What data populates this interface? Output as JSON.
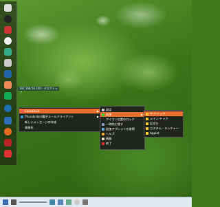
{
  "window": {
    "title_bar_text": "192.168.56.100 - デスクトップ"
  },
  "app_menu": {
    "items": [
      {
        "label": "CairoDock",
        "highlighted": true,
        "has_submenu": true
      },
      {
        "label": "Thunderbird電子メールクライアント",
        "highlighted": false,
        "has_submenu": true
      },
      {
        "label": "新しいメッセージの作成",
        "highlighted": false,
        "has_submenu": false
      },
      {
        "label": "連絡先",
        "highlighted": false,
        "has_submenu": false
      }
    ]
  },
  "cairo_menu": {
    "items": [
      {
        "label": "設定",
        "highlighted": false
      },
      {
        "label": "追加",
        "highlighted": true,
        "has_submenu": true
      },
      {
        "label": "アイコン位置のロック",
        "highlighted": false
      },
      {
        "label": "一時的に隠す",
        "highlighted": false
      },
      {
        "label": "追加アプレットを取得",
        "highlighted": false
      },
      {
        "label": "ヘルプ",
        "highlighted": false
      },
      {
        "label": "情報",
        "highlighted": false
      },
      {
        "label": "終了",
        "highlighted": false
      }
    ]
  },
  "add_menu": {
    "items": [
      {
        "label": "サブ-ドック",
        "highlighted": true
      },
      {
        "label": "メイン-ドック",
        "highlighted": false
      },
      {
        "label": "区切り",
        "highlighted": false
      },
      {
        "label": "カスタム・ランチャー",
        "highlighted": false
      },
      {
        "label": "Applet",
        "highlighted": false
      }
    ]
  },
  "colors": {
    "highlight": "#e8702c",
    "menu_bg": "#1e1e1e"
  }
}
